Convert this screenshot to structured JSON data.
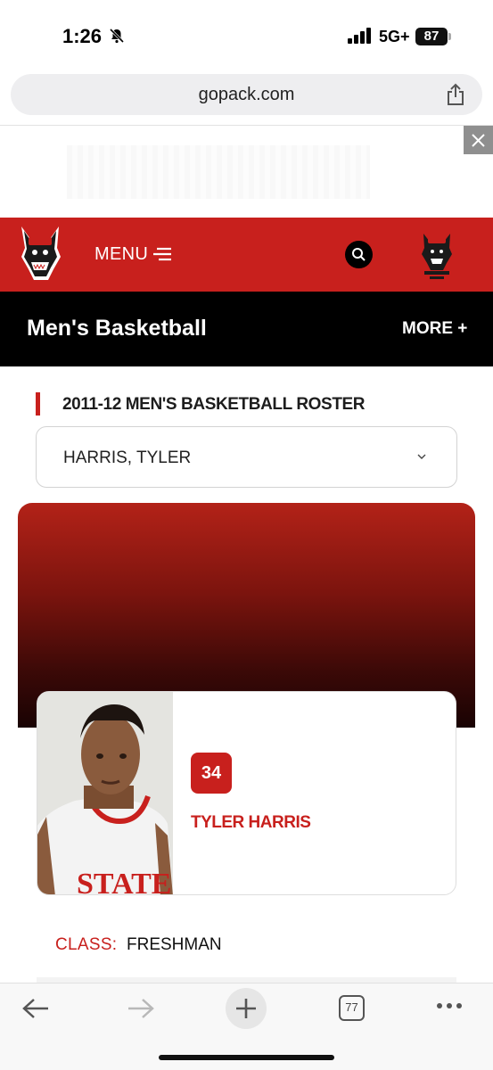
{
  "status_bar": {
    "time": "1:26",
    "network": "5G+",
    "battery": "87",
    "icons": [
      "bell-slash-icon",
      "signal-icon"
    ]
  },
  "browser": {
    "url": "gopack.com",
    "share_icon": "share-icon",
    "tabs_count": "77"
  },
  "ad": {
    "close_icon": "close-icon"
  },
  "nav": {
    "menu_label": "MENU",
    "logo_icon": "wolf-logo-icon",
    "search_icon": "search-icon",
    "club_logo_icon": "wolfpack-club-logo-icon"
  },
  "sport": {
    "title": "Men's Basketball",
    "more_label": "MORE +"
  },
  "roster": {
    "title": "2011-12 MEN'S BASKETBALL ROSTER",
    "selected_player": "HARRIS, TYLER"
  },
  "player": {
    "number": "34",
    "name": "TYLER HARRIS",
    "class_label": "CLASS:",
    "class_value": "FRESHMAN"
  },
  "colors": {
    "brand_red": "#c8201d",
    "black": "#000000"
  }
}
